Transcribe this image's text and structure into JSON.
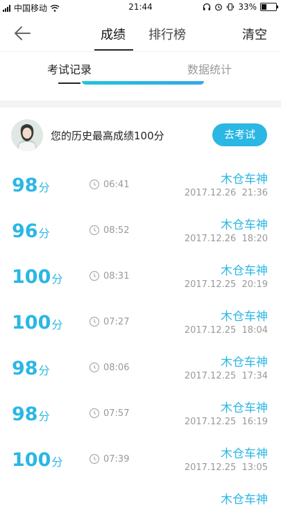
{
  "status_bar": {
    "carrier": "中国移动",
    "time": "21:44",
    "battery": "33%",
    "battery_level": 0.33
  },
  "nav": {
    "tabs": [
      "成绩",
      "排行榜"
    ],
    "active_tab": 0,
    "clear_label": "清空"
  },
  "subtabs": [
    "考试记录",
    "数据统计"
  ],
  "best": {
    "text": "您的历史最高成绩100分",
    "button": "去考试"
  },
  "score_unit": "分",
  "records": [
    {
      "score": "98",
      "duration": "06:41",
      "name": "木仓车神",
      "datetime": "2017.12.26  21:36"
    },
    {
      "score": "96",
      "duration": "08:52",
      "name": "木仓车神",
      "datetime": "2017.12.26  18:20"
    },
    {
      "score": "100",
      "duration": "08:31",
      "name": "木仓车神",
      "datetime": "2017.12.25  20:19"
    },
    {
      "score": "100",
      "duration": "07:27",
      "name": "木仓车神",
      "datetime": "2017.12.25  18:04"
    },
    {
      "score": "98",
      "duration": "08:06",
      "name": "木仓车神",
      "datetime": "2017.12.25  17:34"
    },
    {
      "score": "98",
      "duration": "07:57",
      "name": "木仓车神",
      "datetime": "2017.12.25  16:19"
    },
    {
      "score": "100",
      "duration": "07:39",
      "name": "木仓车神",
      "datetime": "2017.12.25  13:05"
    }
  ],
  "partial_next_name": "木仓车神",
  "colors": {
    "accent": "#2ab7e4",
    "text": "#222222",
    "muted": "#999999"
  }
}
